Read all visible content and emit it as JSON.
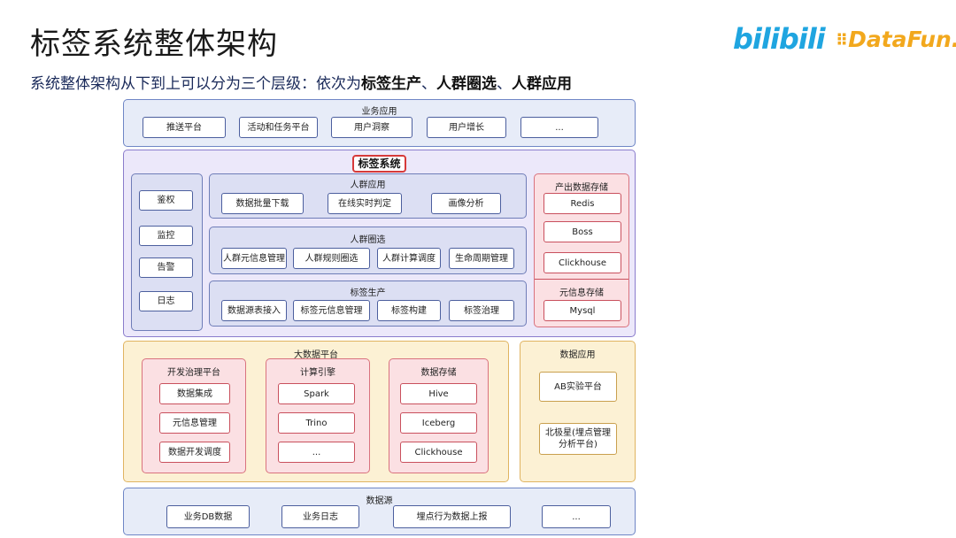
{
  "header": {
    "title": "标签系统整体架构",
    "subtitle_prefix": "系统整体架构从下到上可以分为三个层级：依次为",
    "subtitle_bold1": "标签生产",
    "subtitle_sep1": "、",
    "subtitle_bold2": "人群圈选",
    "subtitle_sep2": "、",
    "subtitle_bold3": "人群应用",
    "logo_bilibili": "bilibili",
    "logo_datafun": "DataFun."
  },
  "biz_app": {
    "title": "业务应用",
    "items": [
      "推送平台",
      "活动和任务平台",
      "用户洞察",
      "用户增长",
      "..."
    ]
  },
  "tag_system": {
    "title": "标签系统",
    "left_items": [
      "鉴权",
      "监控",
      "告警",
      "日志"
    ],
    "crowd_app": {
      "title": "人群应用",
      "items": [
        "数据批量下载",
        "在线实时判定",
        "画像分析"
      ]
    },
    "crowd_select": {
      "title": "人群圈选",
      "items": [
        "人群元信息管理",
        "人群规则圈选",
        "人群计算调度",
        "生命周期管理"
      ]
    },
    "tag_prod": {
      "title": "标签生产",
      "items": [
        "数据源表接入",
        "标签元信息管理",
        "标签构建",
        "标签治理"
      ]
    },
    "output_storage": {
      "title": "产出数据存储",
      "items": [
        "Redis",
        "Boss",
        "Clickhouse"
      ]
    },
    "meta_storage": {
      "title": "元信息存储",
      "items": [
        "Mysql"
      ]
    }
  },
  "bigdata": {
    "title": "大数据平台",
    "dev": {
      "title": "开发治理平台",
      "items": [
        "数据集成",
        "元信息管理",
        "数据开发调度"
      ]
    },
    "compute": {
      "title": "计算引擎",
      "items": [
        "Spark",
        "Trino",
        "..."
      ]
    },
    "storage": {
      "title": "数据存储",
      "items": [
        "Hive",
        "Iceberg",
        "Clickhouse"
      ]
    }
  },
  "data_app": {
    "title": "数据应用",
    "items": [
      "AB实验平台",
      "北极星(埋点管理分析平台)"
    ]
  },
  "data_source": {
    "title": "数据源",
    "items": [
      "业务DB数据",
      "业务日志",
      "埋点行为数据上报",
      "..."
    ]
  },
  "colors": {
    "blue_panel": "#e7ecf8",
    "purple_panel": "#ece8fa",
    "yellow_panel": "#fcf1d4",
    "red_panel": "#fbe0e3",
    "highlight": "#d63a3a"
  }
}
